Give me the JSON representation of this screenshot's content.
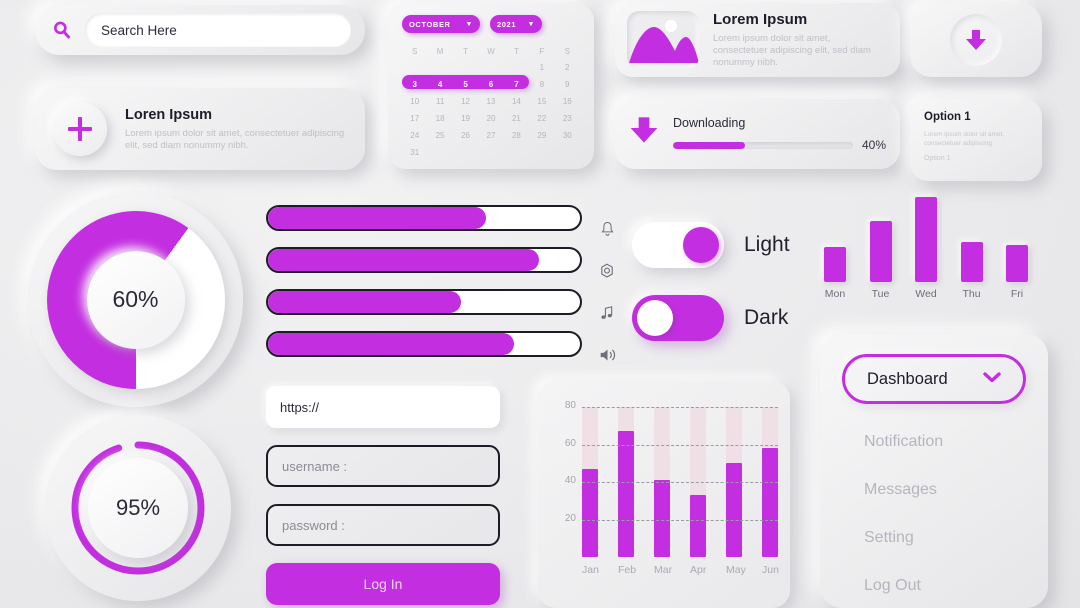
{
  "theme": {
    "accent": "#c32ee0",
    "background": "#ececed",
    "text_dark": "#1d1d2b",
    "text_muted": "#bfbfc6"
  },
  "search": {
    "placeholder": "Search Here",
    "icon": "search-icon"
  },
  "plus_card": {
    "icon": "plus-icon",
    "title": "Loren Ipsum",
    "body": "Lorem ipsum dolor sit amet, consectetuer adipiscing elit, sed diam nonummy nibh."
  },
  "calendar": {
    "month": "OCTOBER",
    "year": "2021",
    "month_chevron": "chevron-down-icon",
    "year_chevron": "chevron-down-icon",
    "day_headers": [
      "S",
      "M",
      "T",
      "W",
      "T",
      "F",
      "S"
    ],
    "leading_blanks": 5,
    "days": [
      1,
      2,
      3,
      4,
      5,
      6,
      7,
      8,
      9,
      10,
      11,
      12,
      13,
      14,
      15,
      16,
      17,
      18,
      19,
      20,
      21,
      22,
      23,
      24,
      25,
      26,
      27,
      28,
      29,
      30,
      31
    ],
    "selected_range": [
      3,
      4,
      5,
      6,
      7
    ]
  },
  "image_card": {
    "thumb_icon": "image-placeholder-icon",
    "title": "Lorem Ipsum",
    "body": "Lorem ipsum dolor sit amet, consectetuer adipiscing elit, sed diam nonummy nibh."
  },
  "download_button": {
    "icon": "download-icon"
  },
  "downloading": {
    "icon": "download-icon",
    "label": "Downloading",
    "percent_label": "40%",
    "percent": 40
  },
  "option_card": {
    "title": "Option 1",
    "body": "Lorem ipsum dolor sit amet, consectetuer adipiscing",
    "sub": "Option 1"
  },
  "donut_60": {
    "label": "60%",
    "value": 60
  },
  "ring_95": {
    "label": "95%",
    "value": 95
  },
  "sliders": [
    {
      "name": "notification-slider",
      "value": 70,
      "icon": "bell-icon"
    },
    {
      "name": "brightness-slider",
      "value": 87,
      "icon": "gear-icon"
    },
    {
      "name": "music-slider",
      "value": 62,
      "icon": "music-note-icon"
    },
    {
      "name": "volume-slider",
      "value": 79,
      "icon": "volume-icon"
    }
  ],
  "toggles": [
    {
      "label": "Light",
      "state": "on",
      "knob": "right"
    },
    {
      "label": "Dark",
      "state": "on-dark",
      "knob": "left"
    }
  ],
  "menu": {
    "selected": "Dashboard",
    "chevron": "chevron-down-icon",
    "items": [
      "Notification",
      "Messages",
      "Setting",
      "Log Out"
    ]
  },
  "form": {
    "url_value": "https://",
    "username_placeholder": "username :",
    "password_placeholder": "password :",
    "submit_label": "Log In"
  },
  "chart_data": [
    {
      "type": "bar",
      "name": "weekday-chart",
      "categories": [
        "Mon",
        "Tue",
        "Wed",
        "Thu",
        "Fri"
      ],
      "values": [
        38,
        66,
        92,
        44,
        40
      ],
      "title": "",
      "xlabel": "",
      "ylabel": "",
      "ylim": [
        0,
        100
      ],
      "grid": false,
      "legend": "none"
    },
    {
      "type": "bar",
      "name": "monthly-chart",
      "categories": [
        "Jan",
        "Feb",
        "Mar",
        "Apr",
        "May",
        "Jun"
      ],
      "values": [
        47,
        67,
        41,
        33,
        50,
        58
      ],
      "track_max": 80,
      "yticks": [
        20,
        40,
        60,
        80
      ],
      "title": "",
      "xlabel": "",
      "ylabel": "",
      "ylim": [
        0,
        80
      ],
      "grid": true,
      "legend": "none"
    }
  ]
}
